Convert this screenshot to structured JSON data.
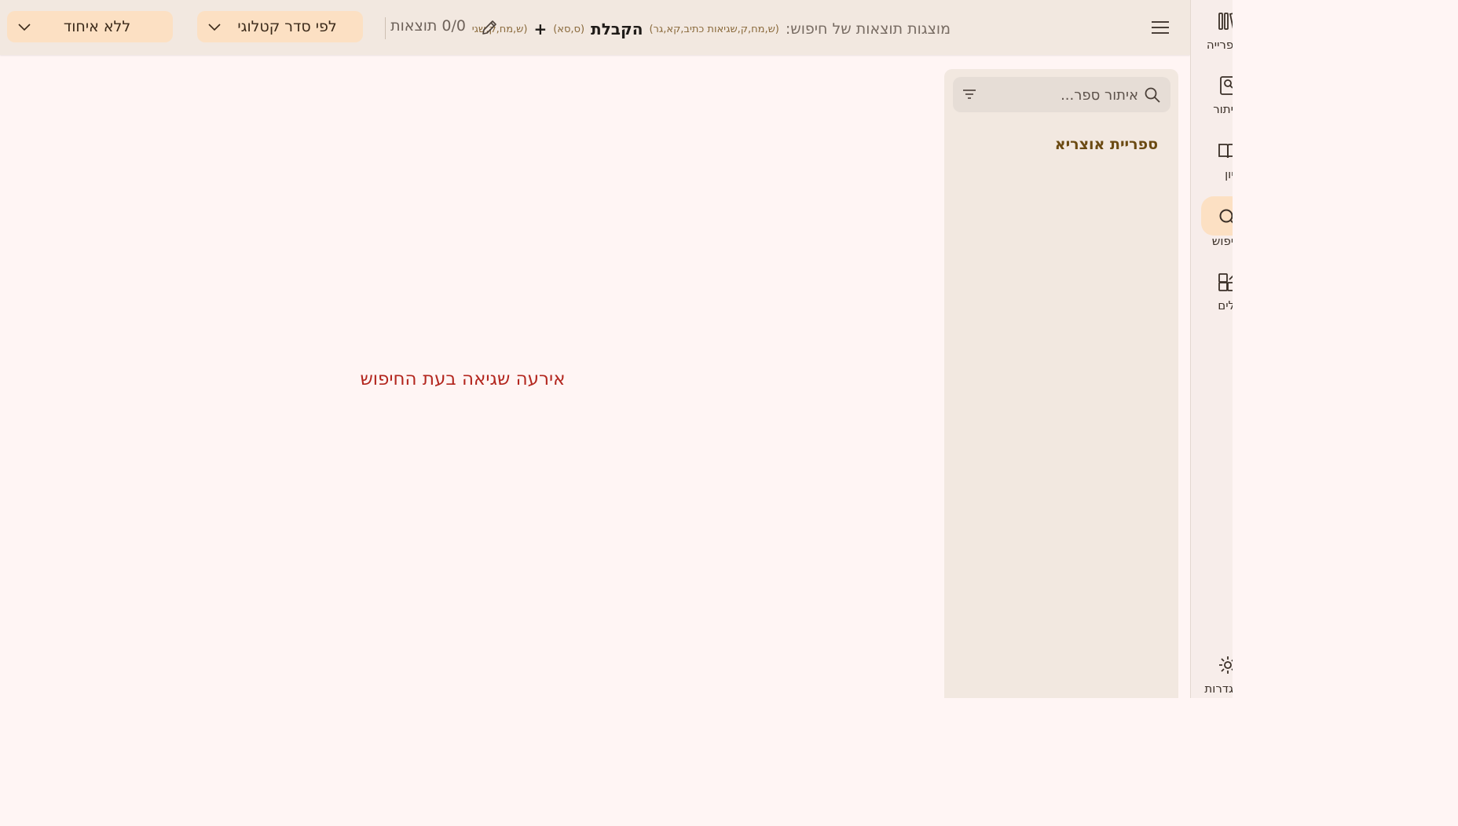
{
  "header": {
    "summary_prefix": "מוצגות תוצאות של חיפוש:",
    "term1_note": "(ש,מח,ק,שגיאות כתיב,קא,גר)",
    "term1": "הקבלת",
    "term2_note": "(ס,סא)",
    "plus": "+",
    "term3_note": "(ש,מח,ק,שגיאות כ",
    "results_count": "0/0 תוצאות",
    "sort_label": "לפי סדר קטלוגי",
    "group_label": "ללא איחוד"
  },
  "main": {
    "error_message": "אירעה שגיאה בעת החיפוש"
  },
  "library": {
    "search_placeholder": "איתור ספר...",
    "title": "ספריית אוצריא"
  },
  "nav": {
    "library_label": "ספרייה",
    "find_label": "איתור",
    "study_label": "עיון",
    "search_label": "חיפוש",
    "tools_label": "כלים",
    "settings_label": "הגדרות"
  },
  "colors": {
    "accent": "#fce0c3",
    "error": "#b3261e",
    "title": "#6b4a12"
  },
  "icons": [
    "menu-icon",
    "edit-icon",
    "chevron-down-icon",
    "search-icon",
    "filter-icon",
    "library-icon",
    "find-book-icon",
    "book-open-icon",
    "search-nav-icon",
    "tools-icon",
    "settings-icon"
  ]
}
